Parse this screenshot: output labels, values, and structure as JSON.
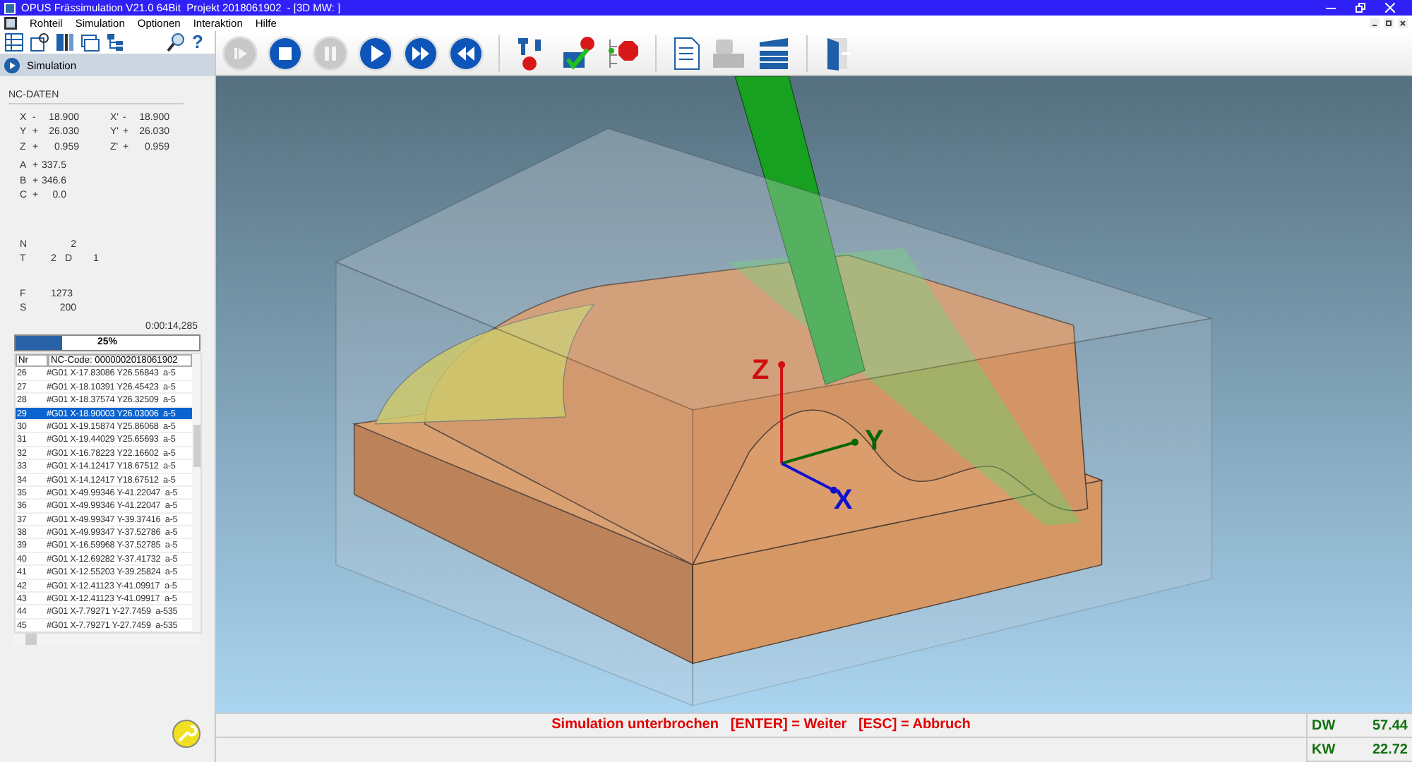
{
  "window": {
    "title": "OPUS Frässimulation V21.0 64Bit  Projekt 2018061902",
    "subtitle": "- [3D MW: ]"
  },
  "menu": [
    "Rohteil",
    "Simulation",
    "Optionen",
    "Interaktion",
    "Hilfe"
  ],
  "panel": {
    "header": "Simulation",
    "help": "?"
  },
  "media_buttons": [
    {
      "kind": "step",
      "disabled": true
    },
    {
      "kind": "stop",
      "disabled": false
    },
    {
      "kind": "pause",
      "disabled": true
    },
    {
      "kind": "play",
      "disabled": false
    },
    {
      "kind": "forward",
      "disabled": false
    },
    {
      "kind": "rewind",
      "disabled": false
    }
  ],
  "nc": {
    "title": "NC-DATEN",
    "linear": [
      {
        "name": "X",
        "sign": "-",
        "value": "18.900",
        "name2": "X'",
        "sign2": "-",
        "value2": "18.900"
      },
      {
        "name": "Y",
        "sign": "+",
        "value": "26.030",
        "name2": "Y'",
        "sign2": "+",
        "value2": "26.030"
      },
      {
        "name": "Z",
        "sign": "+",
        "value": "0.959",
        "name2": "Z'",
        "sign2": "+",
        "value2": "0.959"
      }
    ],
    "rotary": [
      {
        "name": "A",
        "sign": "+",
        "value": "337.5"
      },
      {
        "name": "B",
        "sign": "+",
        "value": "346.6"
      },
      {
        "name": "C",
        "sign": "+",
        "value": "0.0"
      }
    ],
    "n_label": "N",
    "n_value": "2",
    "t_label": "T",
    "t_value": "2",
    "d_label": "D",
    "d_value": "1",
    "f_label": "F",
    "f_value": "1273",
    "s_label": "S",
    "s_value": "200",
    "time": "0:00:14,285"
  },
  "progress": {
    "level": 0.25,
    "label": "25%"
  },
  "code_table": {
    "columns": [
      "Nr",
      "NC-Code: 0000002018061902"
    ],
    "rows": [
      {
        "nr": "26",
        "code": "#G01 X-17.83086 Y26.56843  a-5",
        "selected": false
      },
      {
        "nr": "27",
        "code": "#G01 X-18.10391 Y26.45423  a-5",
        "selected": false
      },
      {
        "nr": "28",
        "code": "#G01 X-18.37574 Y26.32509  a-5",
        "selected": false
      },
      {
        "nr": "29",
        "code": "#G01 X-18.90003 Y26.03006  a-5",
        "selected": true
      },
      {
        "nr": "30",
        "code": "#G01 X-19.15874 Y25.86068  a-5",
        "selected": false
      },
      {
        "nr": "31",
        "code": "#G01 X-19.44029 Y25.65693  a-5",
        "selected": false
      },
      {
        "nr": "32",
        "code": "#G01 X-16.78223 Y22.16602  a-5",
        "selected": false
      },
      {
        "nr": "33",
        "code": "#G01 X-14.12417 Y18.67512  a-5",
        "selected": false
      },
      {
        "nr": "34",
        "code": "#G01 X-14.12417 Y18.67512  a-5",
        "selected": false
      },
      {
        "nr": "35",
        "code": "#G01 X-49.99346 Y-41.22047  a-5",
        "selected": false
      },
      {
        "nr": "36",
        "code": "#G01 X-49.99346 Y-41.22047  a-5",
        "selected": false
      },
      {
        "nr": "37",
        "code": "#G01 X-49.99347 Y-39.37416  a-5",
        "selected": false
      },
      {
        "nr": "38",
        "code": "#G01 X-49.99347 Y-37.52786  a-5",
        "selected": false
      },
      {
        "nr": "39",
        "code": "#G01 X-16.59968 Y-37.52785  a-5",
        "selected": false
      },
      {
        "nr": "40",
        "code": "#G01 X-12.69282 Y-37.41732  a-5",
        "selected": false
      },
      {
        "nr": "41",
        "code": "#G01 X-12.55203 Y-39.25824  a-5",
        "selected": false
      },
      {
        "nr": "42",
        "code": "#G01 X-12.41123 Y-41.09917  a-5",
        "selected": false
      },
      {
        "nr": "43",
        "code": "#G01 X-12.41123 Y-41.09917  a-5",
        "selected": false
      },
      {
        "nr": "44",
        "code": "#G01 X-7.79271 Y-27.7459  a-535",
        "selected": false
      },
      {
        "nr": "45",
        "code": "#G01 X-7.79271 Y-27.7459  a-535",
        "selected": false
      }
    ]
  },
  "viewport": {
    "axes": [
      {
        "label": "Z",
        "color": "#d01010"
      },
      {
        "label": "Y",
        "color": "#066606"
      },
      {
        "label": "X",
        "color": "#1010d0"
      }
    ]
  },
  "status": {
    "message": "Simulation unterbrochen   [ENTER] = Weiter   [ESC] = Abbruch",
    "readings": [
      {
        "label": "DW",
        "value": "57.44"
      },
      {
        "label": "KW",
        "value": "22.72"
      }
    ]
  }
}
